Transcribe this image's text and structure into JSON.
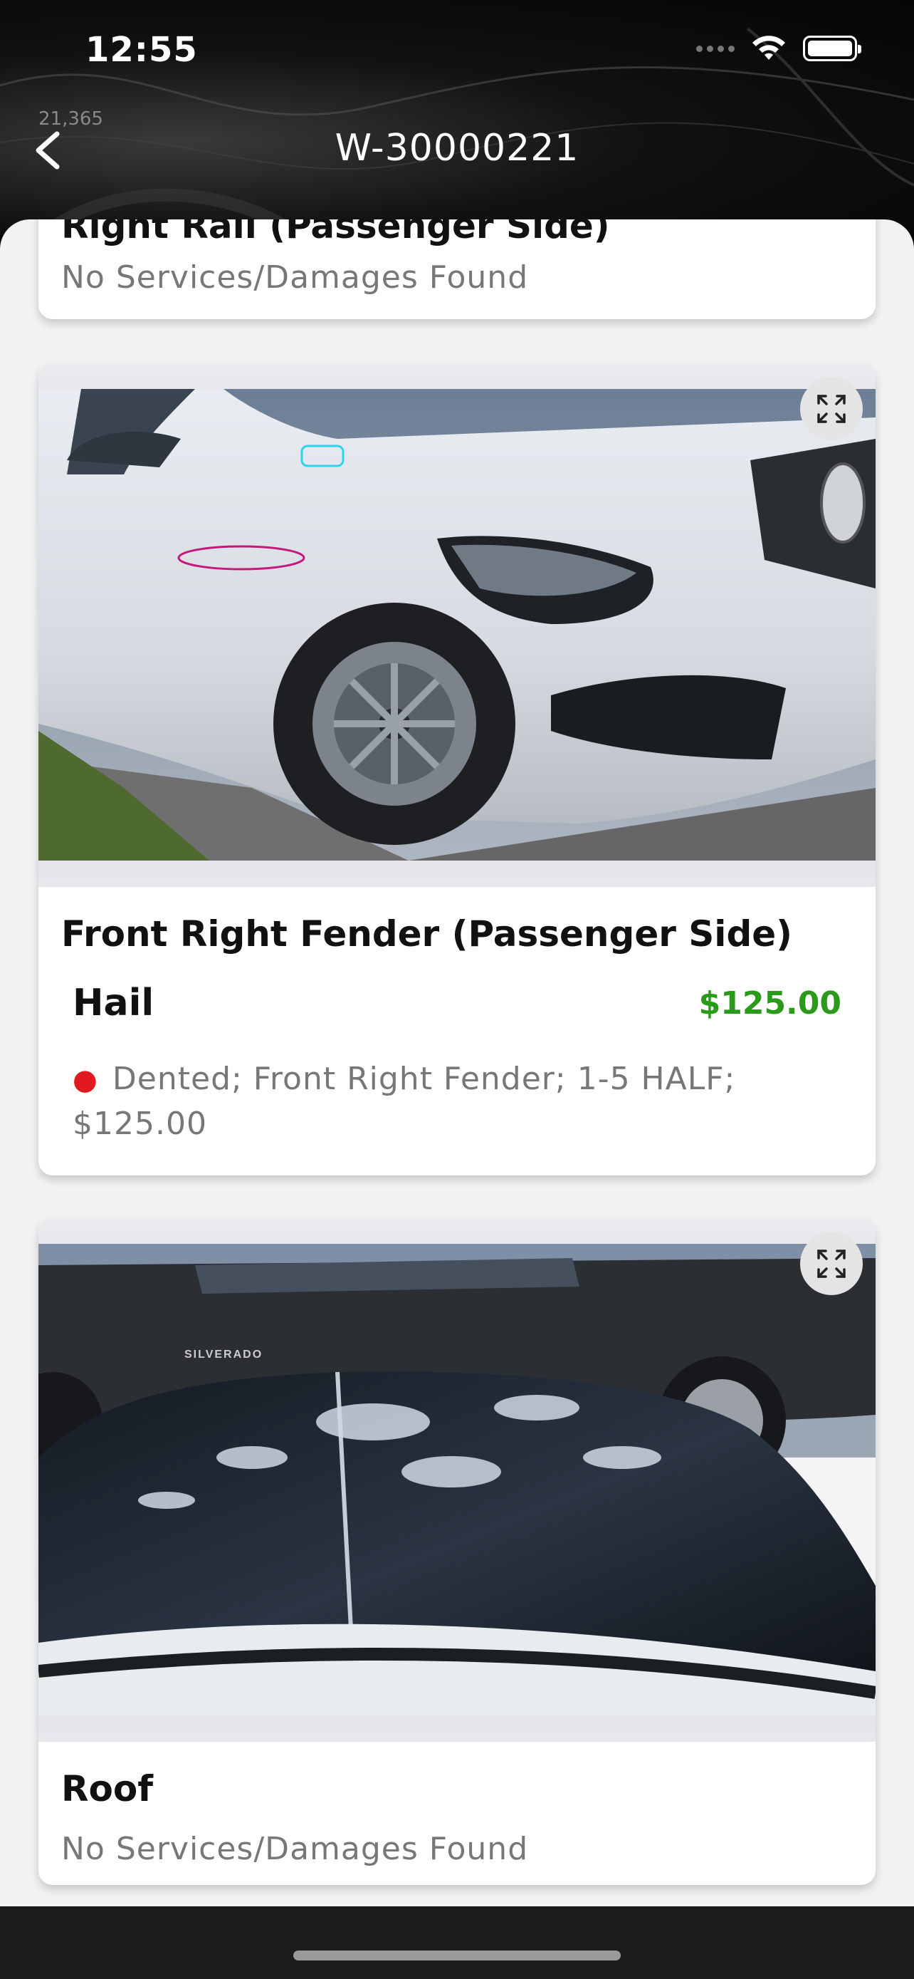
{
  "status_bar": {
    "time": "12:55"
  },
  "header": {
    "title": "W-30000221",
    "background_text": "21,365"
  },
  "cards": [
    {
      "title": "Right Rail (Passenger Side)",
      "status": "No Services/Damages Found"
    },
    {
      "title": "Front Right Fender (Passenger Side)",
      "damage_type": "Hail",
      "price": "$125.00",
      "detail": "Dented; Front Right Fender; 1-5 HALF; $125.00"
    },
    {
      "title": "Roof",
      "status": "No Services/Damages Found",
      "photo_text": "SILVERADO"
    }
  ],
  "colors": {
    "price_green": "#2a9a1a",
    "bullet_red": "#e0191e",
    "panel_bg": "#f2f2f2"
  },
  "icons": [
    "back-chevron-icon",
    "expand-icon",
    "wifi-icon",
    "battery-icon",
    "signal-icon"
  ]
}
